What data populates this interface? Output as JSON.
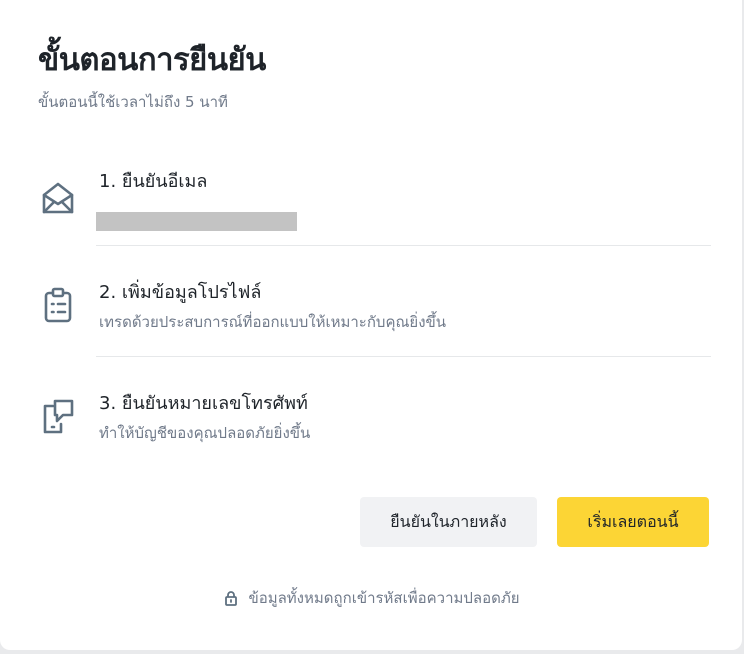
{
  "header": {
    "title": "ขั้นตอนการยืนยัน",
    "subtitle": "ขั้นตอนนี้ใช้เวลาไม่ถึง 5 นาที"
  },
  "steps": [
    {
      "icon": "envelope-open-icon",
      "title": "1. ยืนยันอีเมล",
      "description": ""
    },
    {
      "icon": "clipboard-list-icon",
      "title": "2. เพิ่มข้อมูลโปรไฟล์",
      "description": "เทรดด้วยประสบการณ์ที่ออกแบบให้เหมาะกับคุณยิ่งขึ้น"
    },
    {
      "icon": "phone-verify-icon",
      "title": "3. ยืนยันหมายเลขโทรศัพท์",
      "description": "ทำให้บัญชีของคุณปลอดภัยยิ่งขึ้น"
    }
  ],
  "buttons": {
    "later": "ยืนยันในภายหลัง",
    "start": "เริ่มเลยตอนนี้"
  },
  "footer": {
    "icon": "lock-icon",
    "text": "ข้อมูลทั้งหมดถูกเข้ารหัสเพื่อความปลอดภัย"
  },
  "colors": {
    "primary": "#FCD535",
    "text": "#1E2329",
    "muted": "#707A8A",
    "icon": "#5E7080"
  }
}
